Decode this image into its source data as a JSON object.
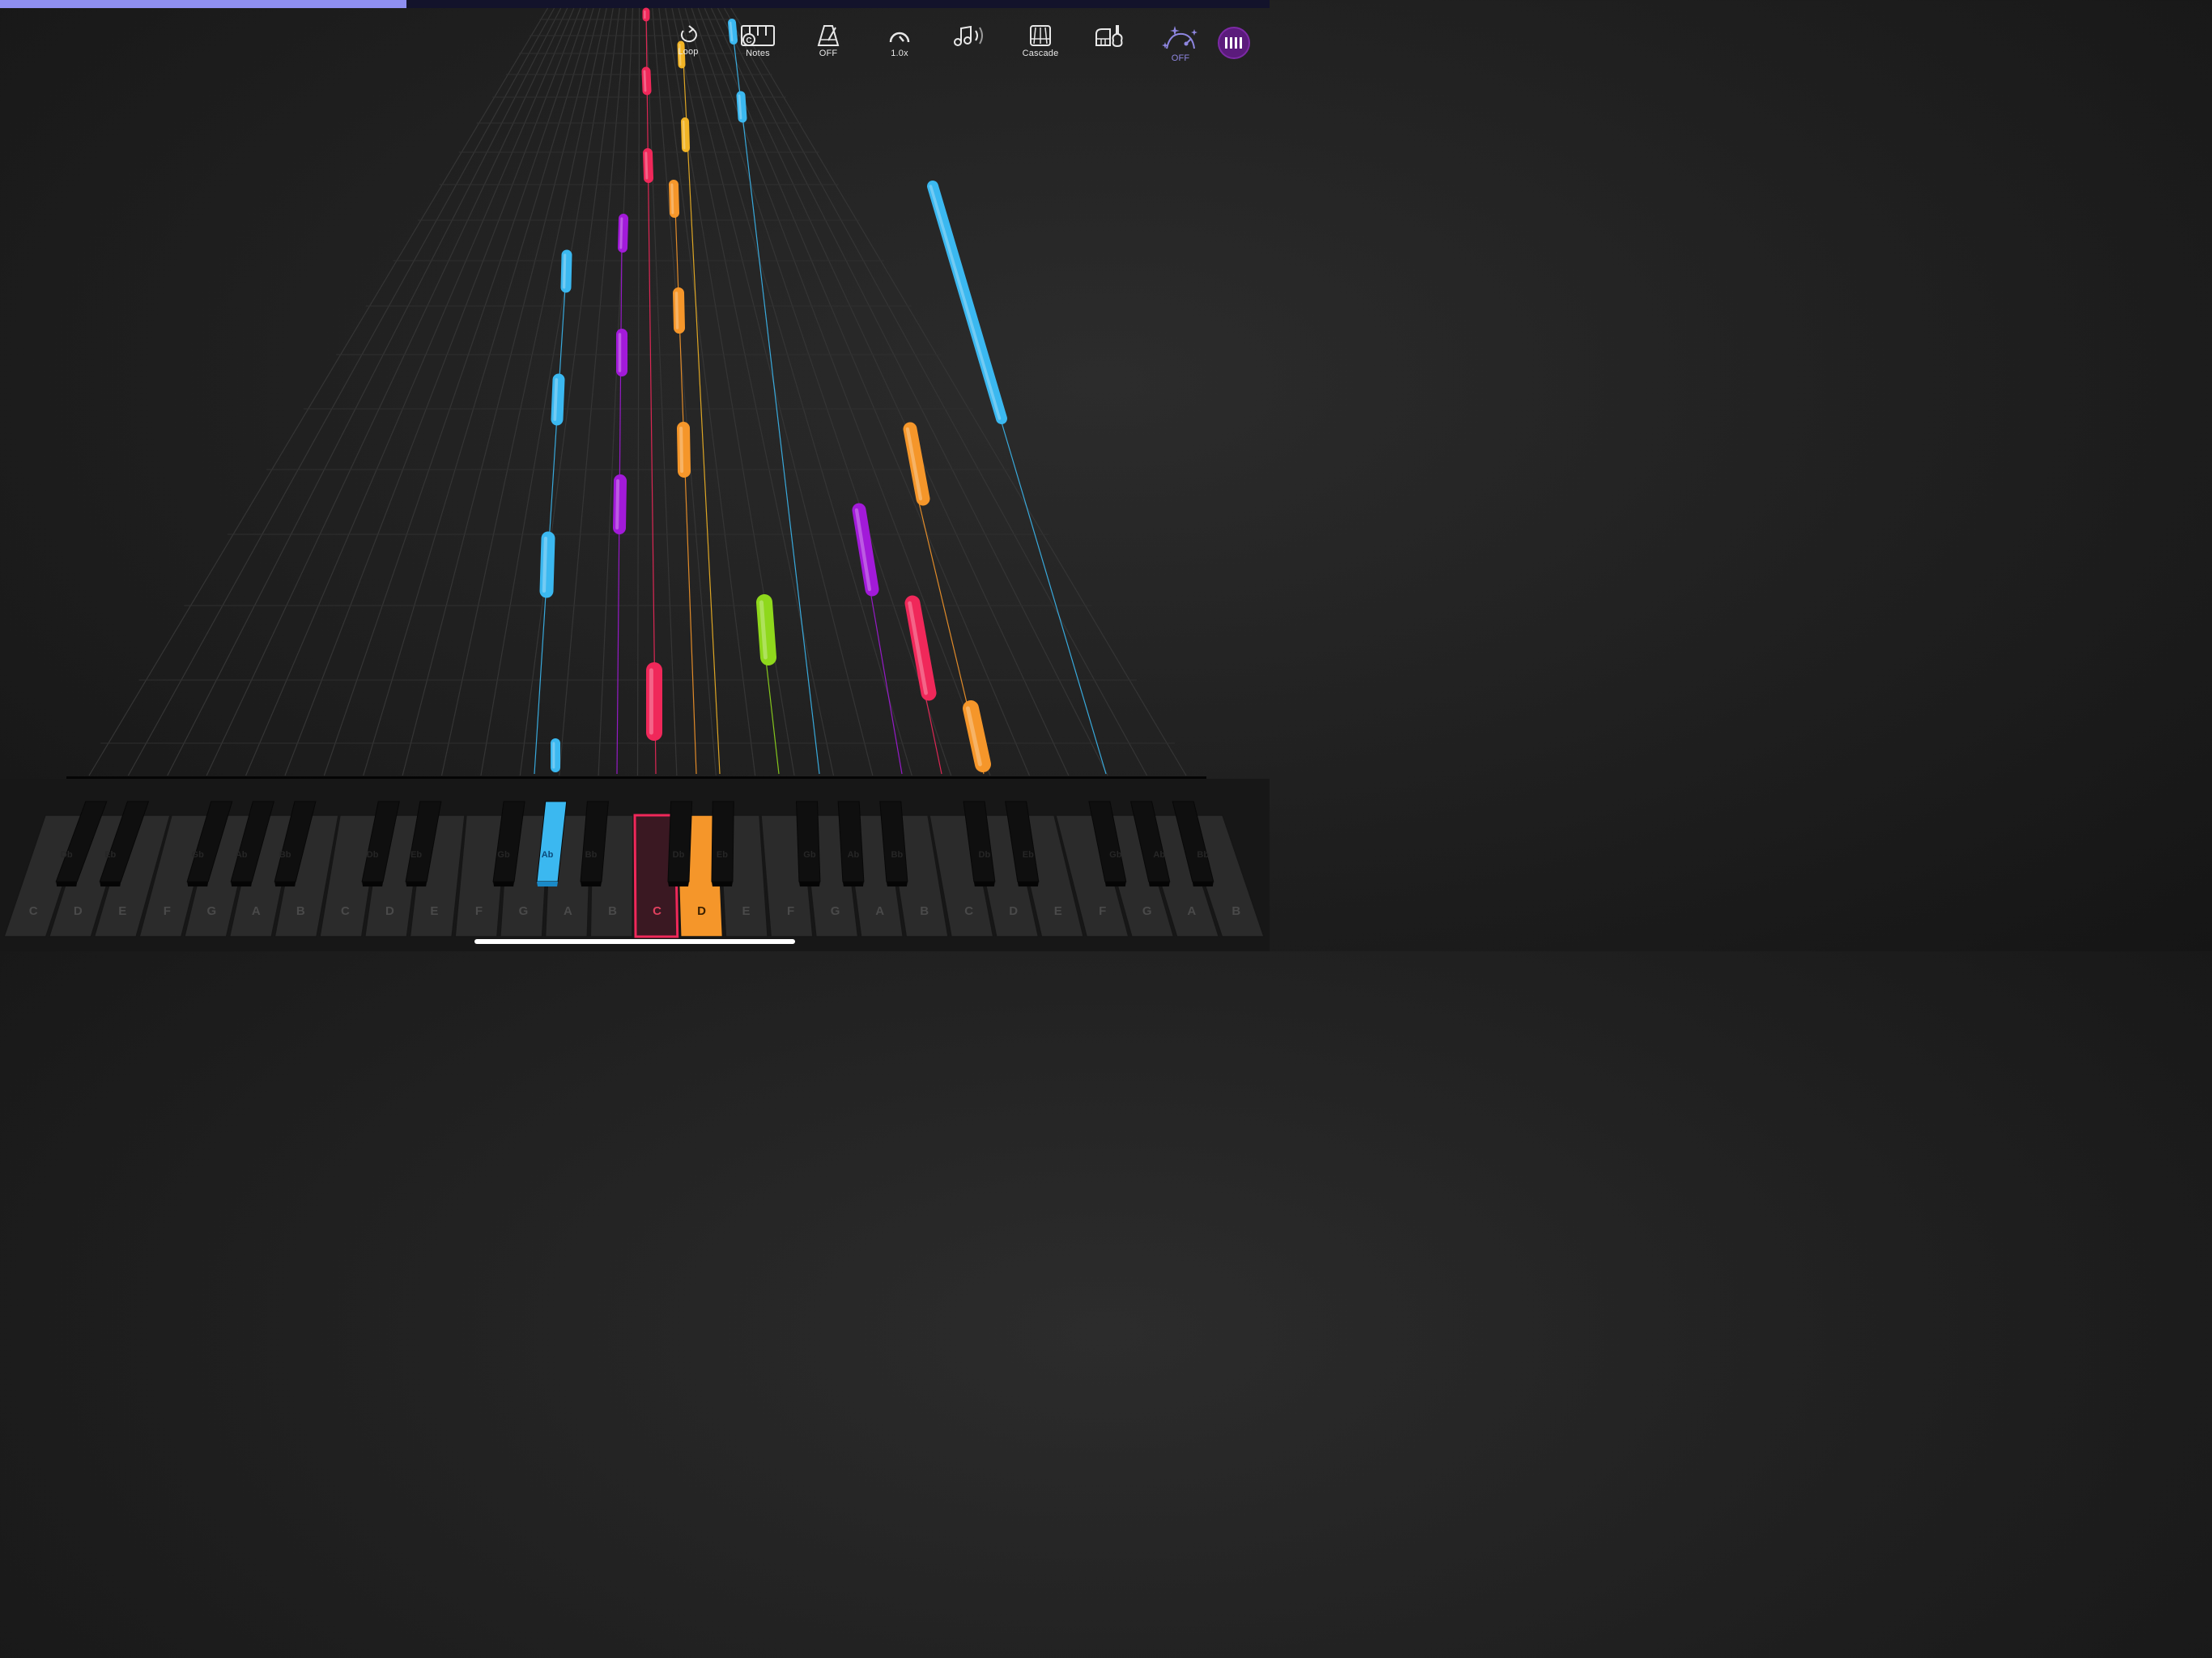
{
  "playback": {
    "progress_fraction": 0.32
  },
  "toolbar": {
    "loop_label": "Loop",
    "notes_label": "Notes",
    "notes_badge": "C",
    "metronome_label": "OFF",
    "speed_label": "1.0x",
    "mode_label": "Cascade",
    "effects_label": "OFF"
  },
  "colors": {
    "blue": "#3bb8f0",
    "red": "#f0285a",
    "orange": "#f5962a",
    "yellow": "#f2b425",
    "purple": "#a21ad9",
    "green": "#8fd81c",
    "accent": "#8f8ff0"
  },
  "keyboard": {
    "white_keys": [
      "C",
      "D",
      "E",
      "F",
      "G",
      "A",
      "B",
      "C",
      "D",
      "E",
      "F",
      "G",
      "A",
      "B",
      "C",
      "D",
      "E",
      "F",
      "G",
      "A",
      "B",
      "C",
      "D",
      "E",
      "F",
      "G",
      "A",
      "B"
    ],
    "black_keys": [
      "Db",
      "Eb",
      "Gb",
      "Ab",
      "Bb",
      "Db",
      "Eb",
      "Gb",
      "Ab",
      "Bb",
      "Db",
      "Eb",
      "Gb",
      "Ab",
      "Bb",
      "Db",
      "Eb",
      "Gb",
      "Ab",
      "Bb"
    ],
    "active_white": [
      {
        "index": 15,
        "color": "orange"
      },
      {
        "index": 14,
        "color": "red",
        "outline": true
      }
    ],
    "active_black": [
      {
        "index": 8,
        "color": "blue"
      }
    ]
  },
  "icons": [
    "loop-icon",
    "notes-icon",
    "metronome-icon",
    "speed-dial-icon",
    "sound-icon",
    "cascade-icon",
    "instrument-icon",
    "effects-icon",
    "keyboard-icon"
  ]
}
